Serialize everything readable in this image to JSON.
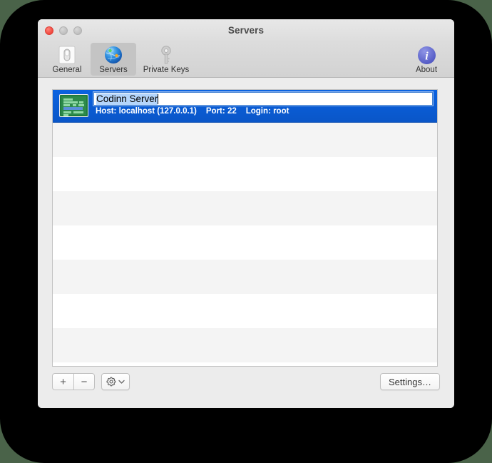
{
  "window": {
    "title": "Servers",
    "traffic_lights": [
      {
        "name": "close",
        "active": true
      },
      {
        "name": "minimize",
        "active": false
      },
      {
        "name": "zoom",
        "active": false
      }
    ]
  },
  "toolbar": {
    "items": [
      {
        "label": "General",
        "icon": "light-switch-icon",
        "selected": false
      },
      {
        "label": "Servers",
        "icon": "globe-icon",
        "selected": true
      },
      {
        "label": "Private Keys",
        "icon": "key-icon",
        "selected": false
      }
    ],
    "about": {
      "label": "About",
      "icon": "info-circle-icon"
    }
  },
  "server_list": {
    "selected_server": {
      "icon": "terminal-screen-icon",
      "name_field_value": "Codinn Server",
      "name_field_editing": true,
      "host_label": "Host:",
      "host_value": "localhost (127.0.0.1)",
      "port_label": "Port:",
      "port_value": "22",
      "login_label": "Login:",
      "login_value": "root"
    },
    "empty_row_count": 8
  },
  "bottom_bar": {
    "add_label": "+",
    "remove_label": "−",
    "gear_icon": "gear-icon",
    "gear_chevron_icon": "chevron-down-icon",
    "settings_label": "Settings…"
  },
  "colors": {
    "selection_blue": "#0a5bd3",
    "toolbar_selected": "#c4c4c4",
    "window_bg": "#ececec",
    "row_alt": "#f4f4f4",
    "about_blue": "#5b62cd",
    "terminal_green": "#2d8a4b",
    "backdrop": "#4a6349"
  }
}
